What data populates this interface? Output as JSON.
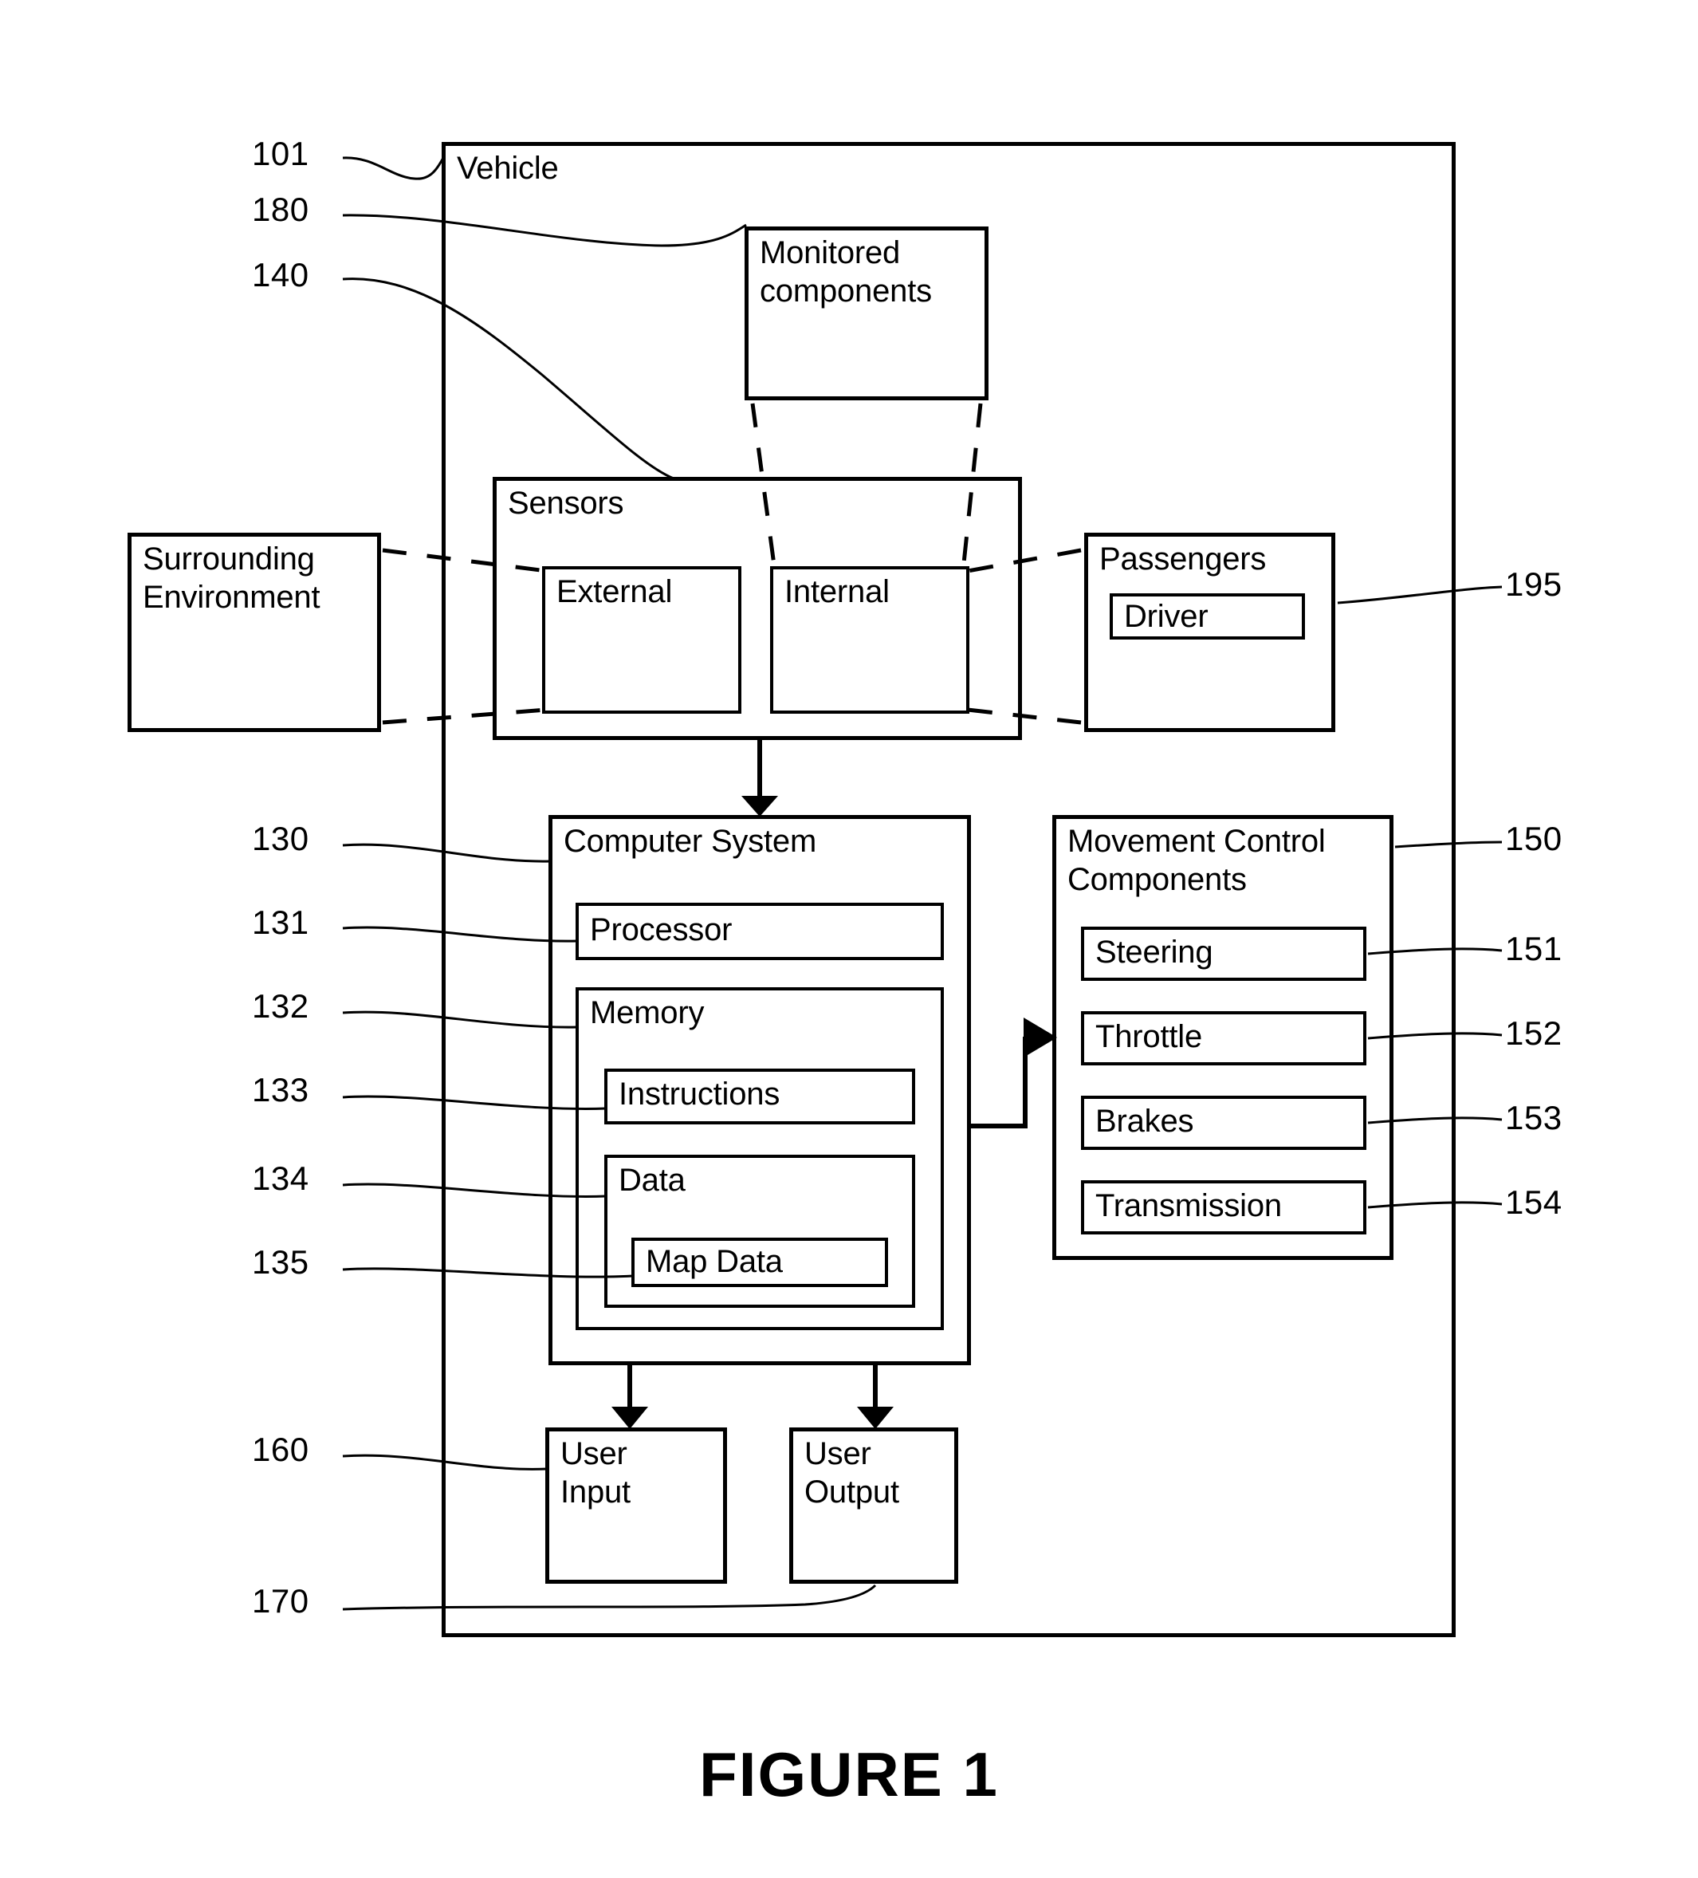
{
  "figure": {
    "caption": "FIGURE 1"
  },
  "diagram": {
    "vehicle": {
      "label": "Vehicle",
      "ref": "101"
    },
    "monitored_components": {
      "label": "Monitored\ncomponents",
      "ref": "180"
    },
    "sensors": {
      "label": "Sensors",
      "ref": "140",
      "external": {
        "label": "External"
      },
      "internal": {
        "label": "Internal"
      }
    },
    "surrounding_environment": {
      "label": "Surrounding\nEnvironment"
    },
    "passengers": {
      "label": "Passengers",
      "ref": "195",
      "driver": {
        "label": "Driver"
      }
    },
    "computer_system": {
      "label": "Computer System",
      "ref": "130",
      "processor": {
        "label": "Processor",
        "ref": "131"
      },
      "memory": {
        "label": "Memory",
        "ref": "132",
        "instructions": {
          "label": "Instructions",
          "ref": "133"
        },
        "data": {
          "label": "Data",
          "ref": "134",
          "map_data": {
            "label": "Map Data",
            "ref": "135"
          }
        }
      }
    },
    "movement_control": {
      "label": "Movement Control\nComponents",
      "ref": "150",
      "items": [
        {
          "label": "Steering",
          "ref": "151"
        },
        {
          "label": "Throttle",
          "ref": "152"
        },
        {
          "label": "Brakes",
          "ref": "153"
        },
        {
          "label": "Transmission",
          "ref": "154"
        }
      ]
    },
    "user_input": {
      "label": "User\nInput",
      "ref": "160"
    },
    "user_output": {
      "label": "User\nOutput",
      "ref": "170"
    }
  },
  "style": {
    "line_color": "#000000",
    "background": "#ffffff"
  }
}
